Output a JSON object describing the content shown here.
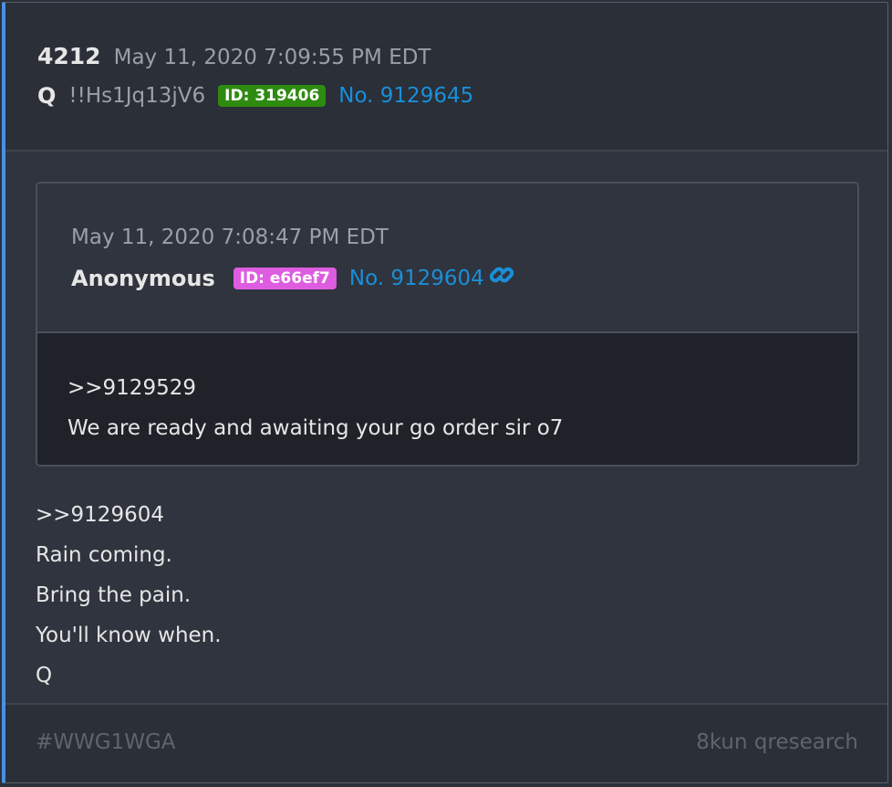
{
  "post": {
    "number": "4212",
    "date": "May 11, 2020 7:09:55 PM EDT",
    "author": "Q",
    "tripcode": "!!Hs1Jq13jV6",
    "id_badge": "ID: 319406",
    "post_link": "No. 9129645"
  },
  "quoted": {
    "date": "May 11, 2020 7:08:47 PM EDT",
    "author": "Anonymous",
    "id_badge": "ID: e66ef7",
    "post_link": "No. 9129604",
    "link_icon": "link-icon",
    "lines": [
      ">>9129529",
      "We are ready and awaiting your go order sir o7"
    ]
  },
  "body_lines": [
    ">>9129604",
    "Rain coming.",
    "Bring the pain.",
    "You'll know when.",
    "Q"
  ],
  "footer": {
    "hashtag": "#WWG1WGA",
    "source": "8kun qresearch"
  },
  "colors": {
    "id_green": "#2e8b10",
    "id_pink": "#de5ce0",
    "link_blue": "#1a8fd8",
    "accent_bar": "#4a90e2"
  }
}
